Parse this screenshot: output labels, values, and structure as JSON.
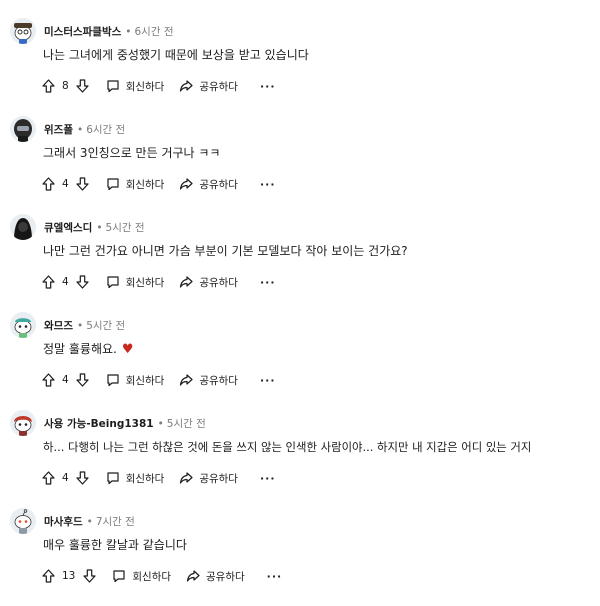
{
  "comments": [
    {
      "username": "미스터스파클박스",
      "time": "6시간 전",
      "text": "나는 그녀에게 중성했기 때문에 보상을 받고 있습니다",
      "votes": "8",
      "reply_label": "회신하다",
      "share_label": "공유하다",
      "more_label": "···",
      "avatar_icon": "snoo-avatar-glasses"
    },
    {
      "username": "위즈폴",
      "time": "6시간 전",
      "text": "그래서 3인칭으로 만든 거구나 ㅋㅋ",
      "votes": "4",
      "reply_label": "회신하다",
      "share_label": "공유하다",
      "more_label": "···",
      "avatar_icon": "snoo-avatar-dark-helmet"
    },
    {
      "username": "큐엘엑스디",
      "time": "5시간 전",
      "text": "나만 그런 건가요 아니면 가슴 부분이 기본 모델보다 작아 보이는 건가요?",
      "votes": "4",
      "reply_label": "회신하다",
      "share_label": "공유하다",
      "more_label": "···",
      "avatar_icon": "snoo-avatar-hooded"
    },
    {
      "username": "와므즈",
      "time": "5시간 전",
      "text": "정말 훌륭해요.",
      "emoji": "♥",
      "votes": "4",
      "reply_label": "회신하다",
      "share_label": "공유하다",
      "more_label": "···",
      "avatar_icon": "snoo-avatar-cap"
    },
    {
      "username": "사용 가능-Being1381",
      "time": "5시간 전",
      "text": "하... 다행히 나는 그런 하찮은 것에 돈을 쓰지 않는 인색한 사람이야... 하지만 내 지갑은 어디 있는 거지",
      "votes": "4",
      "reply_label": "회신하다",
      "share_label": "공유하다",
      "more_label": "···",
      "avatar_icon": "snoo-avatar-red-hair"
    },
    {
      "username": "마사후드",
      "time": "7시간 전",
      "text": "매우 훌륭한 칼날과 같습니다",
      "votes": "13",
      "reply_label": "회신하다",
      "share_label": "공유하다",
      "more_label": "···",
      "avatar_icon": "snoo-avatar-default"
    }
  ],
  "colors": {
    "text": "#1c1c1c",
    "meta": "#7c7c7c",
    "heart": "#c8281e"
  }
}
